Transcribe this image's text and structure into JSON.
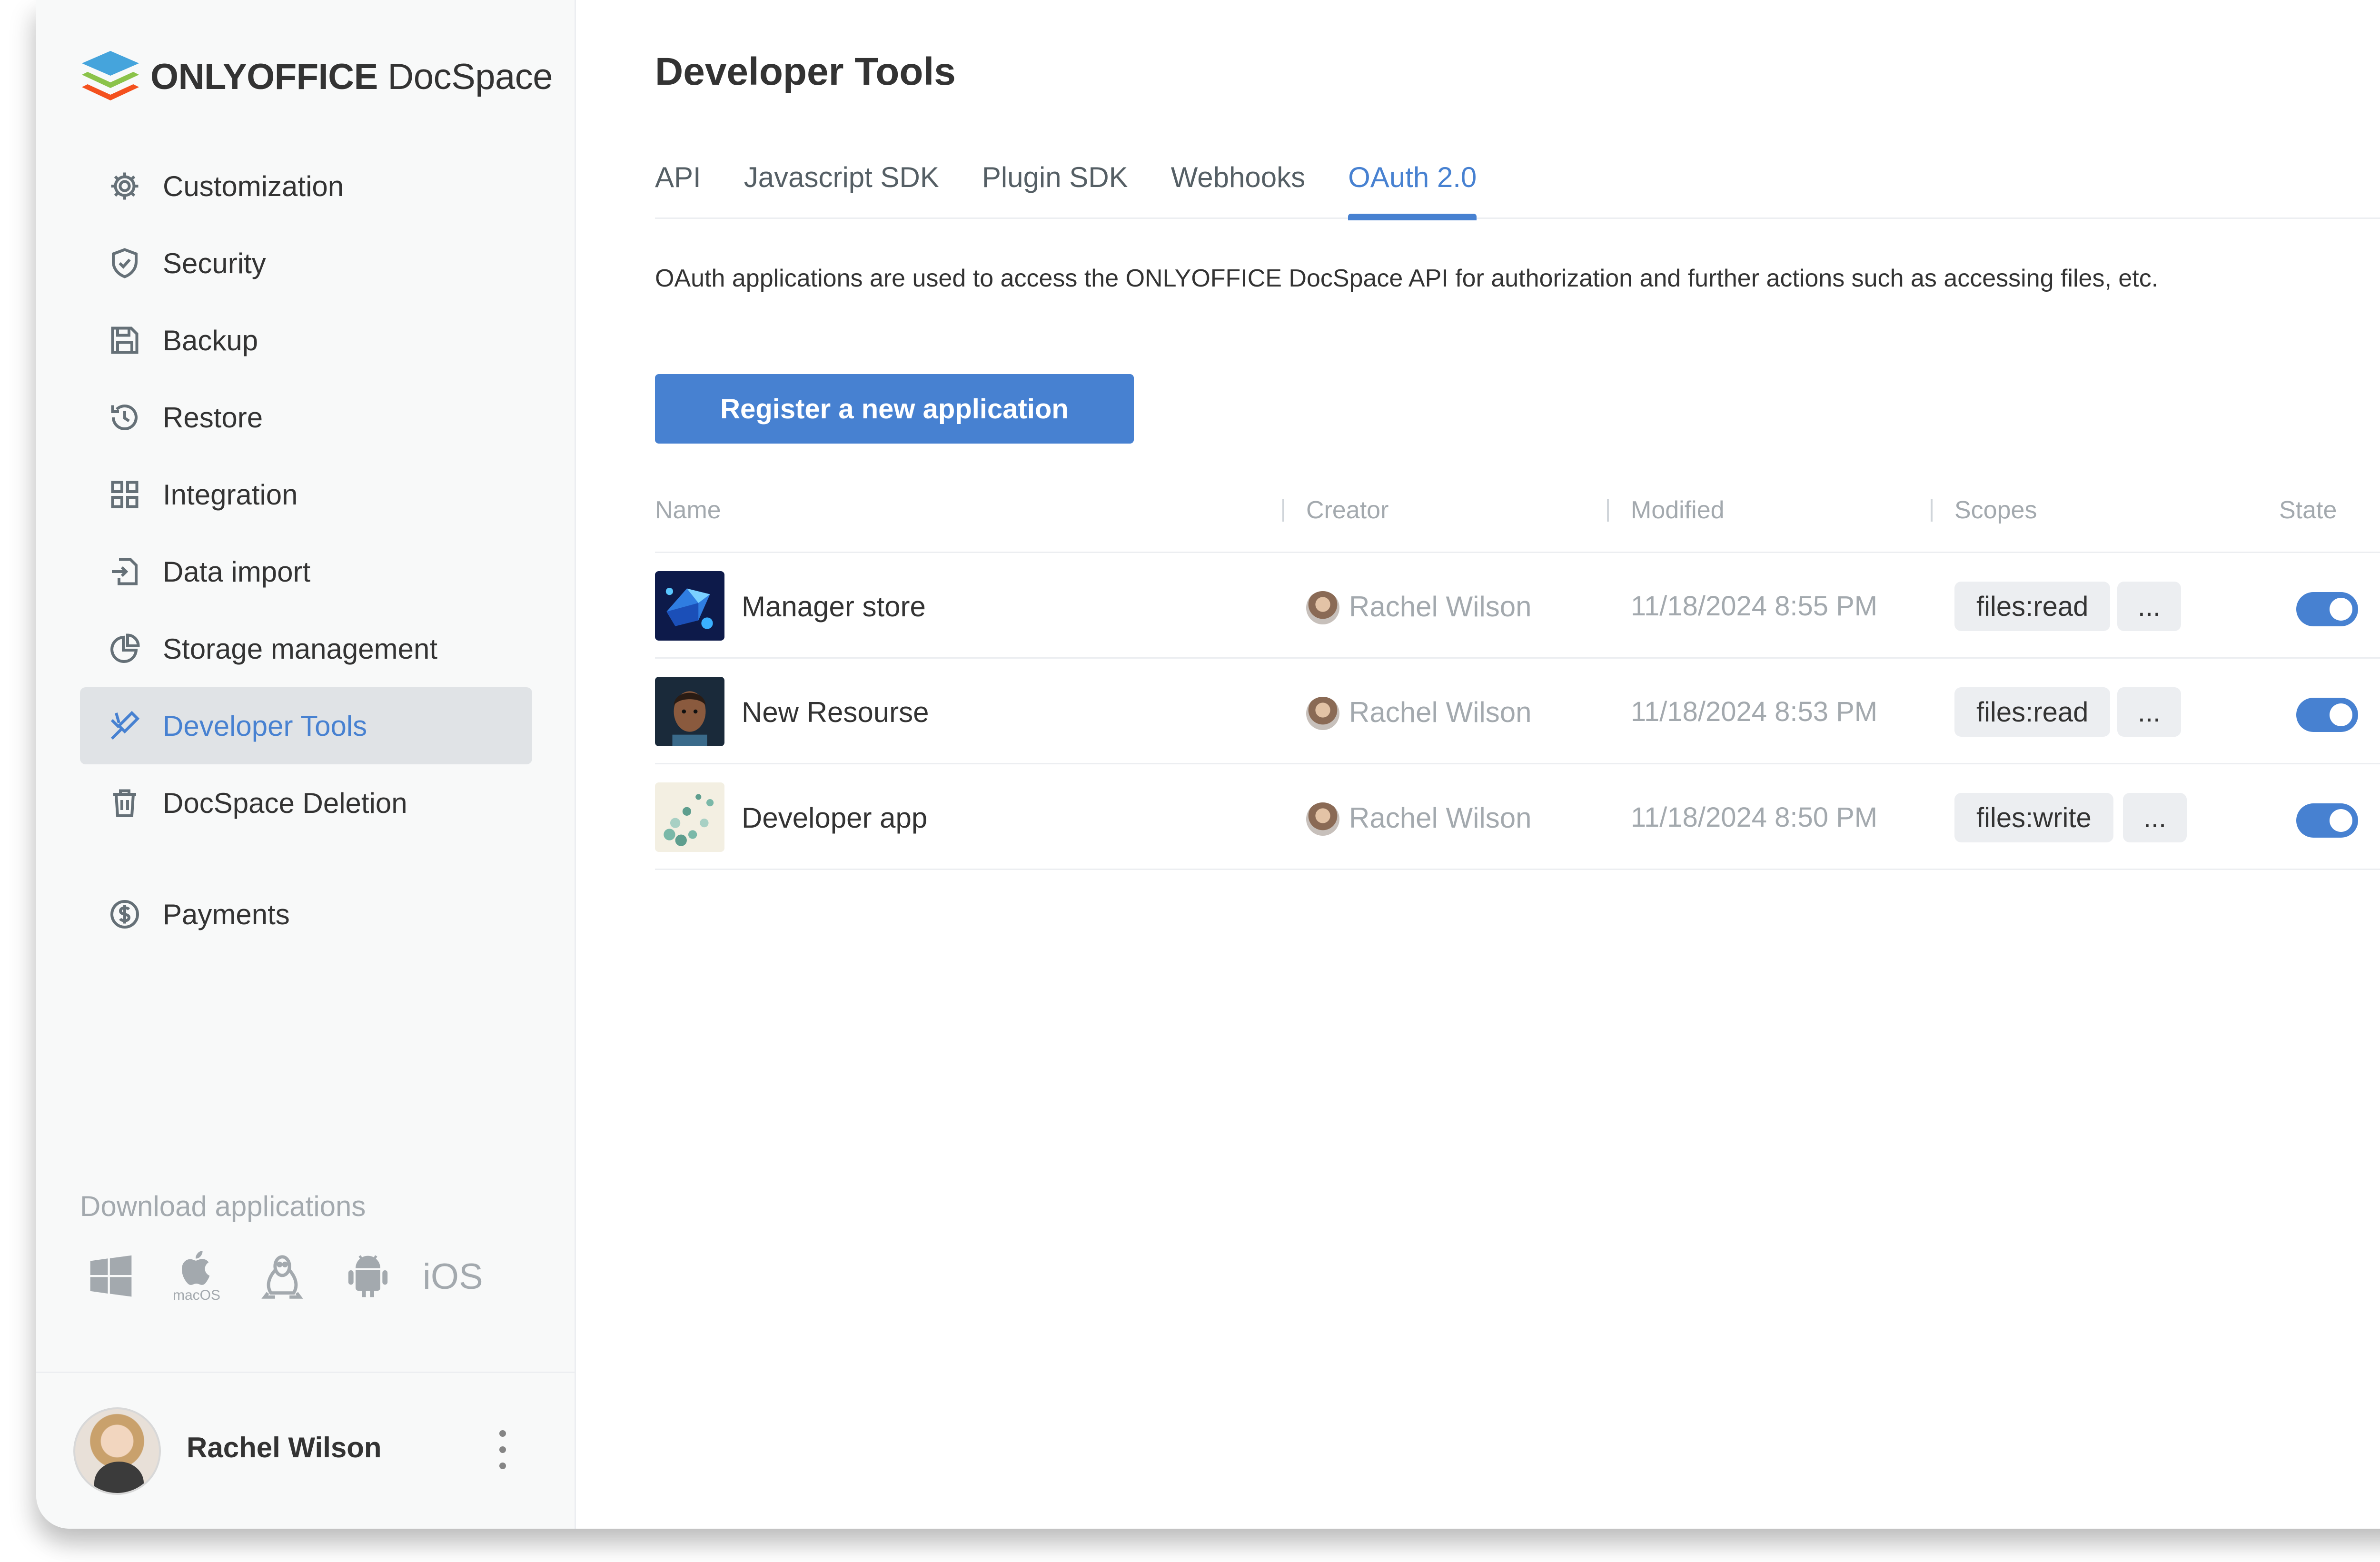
{
  "brand": {
    "name_bold": "ONLYOFFICE",
    "name_regular": "DocSpace"
  },
  "sidebar": {
    "items": [
      {
        "label": "Customization",
        "icon": "gear-icon"
      },
      {
        "label": "Security",
        "icon": "shield-icon"
      },
      {
        "label": "Backup",
        "icon": "floppy-disk-icon"
      },
      {
        "label": "Restore",
        "icon": "history-icon"
      },
      {
        "label": "Integration",
        "icon": "grid-icon"
      },
      {
        "label": "Data import",
        "icon": "import-icon"
      },
      {
        "label": "Storage management",
        "icon": "pie-chart-icon"
      },
      {
        "label": "Developer Tools",
        "icon": "developer-tools-icon",
        "active": true
      },
      {
        "label": "DocSpace Deletion",
        "icon": "trash-icon"
      },
      {
        "label": "Payments",
        "icon": "dollar-circle-icon"
      }
    ],
    "download": {
      "title": "Download applications",
      "macos_label": "macOS",
      "ios_label": "iOS"
    },
    "profile": {
      "name": "Rachel Wilson"
    }
  },
  "main": {
    "title": "Developer Tools",
    "tabs": [
      {
        "label": "API"
      },
      {
        "label": "Javascript SDK"
      },
      {
        "label": "Plugin SDK"
      },
      {
        "label": "Webhooks"
      },
      {
        "label": "OAuth 2.0",
        "active": true
      }
    ],
    "description": "OAuth applications are used to access the ONLYOFFICE DocSpace API for authorization and further actions such as accessing files, etc.",
    "register_button": "Register a new application",
    "table": {
      "columns": {
        "name": "Name",
        "creator": "Creator",
        "modified": "Modified",
        "scopes": "Scopes",
        "state": "State"
      },
      "rows": [
        {
          "name": "Manager store",
          "creator": "Rachel Wilson",
          "modified": "11/18/2024 8:55 PM",
          "scope": "files:read",
          "more": "...",
          "enabled": true
        },
        {
          "name": "New Resourse",
          "creator": "Rachel Wilson",
          "modified": "11/18/2024 8:53 PM",
          "scope": "files:read",
          "more": "...",
          "enabled": true
        },
        {
          "name": "Developer app",
          "creator": "Rachel Wilson",
          "modified": "11/18/2024 8:50 PM",
          "scope": "files:write",
          "more": "...",
          "enabled": true
        }
      ]
    }
  },
  "colors": {
    "accent": "#4781d1",
    "muted_text": "#a3a9ae",
    "sidebar_bg": "#f8f9f9",
    "chip_bg": "#eceef1"
  }
}
